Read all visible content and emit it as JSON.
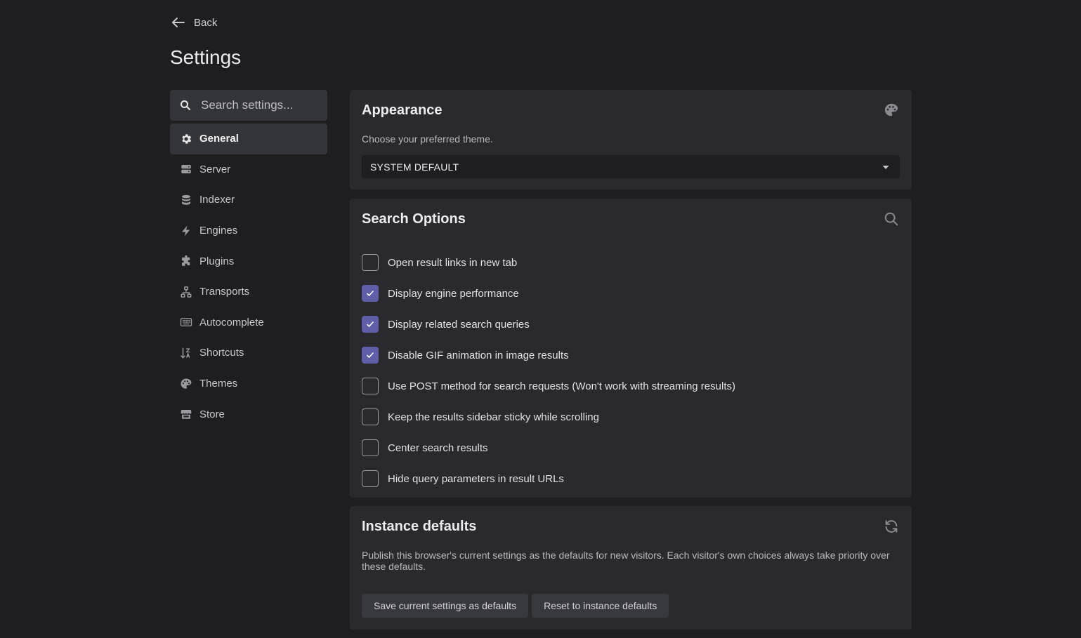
{
  "header": {
    "back_label": "Back",
    "title": "Settings"
  },
  "sidebar": {
    "search_placeholder": "Search settings...",
    "items": [
      {
        "label": "General",
        "icon": "gear-icon",
        "active": true
      },
      {
        "label": "Server",
        "icon": "server-icon"
      },
      {
        "label": "Indexer",
        "icon": "database-icon"
      },
      {
        "label": "Engines",
        "icon": "lightning-icon"
      },
      {
        "label": "Plugins",
        "icon": "puzzle-icon"
      },
      {
        "label": "Transports",
        "icon": "network-icon"
      },
      {
        "label": "Autocomplete",
        "icon": "keyboard-icon"
      },
      {
        "label": "Shortcuts",
        "icon": "sort-icon"
      },
      {
        "label": "Themes",
        "icon": "palette-icon"
      },
      {
        "label": "Store",
        "icon": "store-icon"
      }
    ]
  },
  "appearance": {
    "title": "Appearance",
    "description": "Choose your preferred theme.",
    "theme_value": "SYSTEM DEFAULT",
    "icon": "palette-icon"
  },
  "search_options": {
    "title": "Search Options",
    "icon": "search-icon",
    "options": [
      {
        "label": "Open result links in new tab",
        "checked": false
      },
      {
        "label": "Display engine performance",
        "checked": true
      },
      {
        "label": "Display related search queries",
        "checked": true
      },
      {
        "label": "Disable GIF animation in image results",
        "checked": true
      },
      {
        "label": "Use POST method for search requests (Won't work with streaming results)",
        "checked": false
      },
      {
        "label": "Keep the results sidebar sticky while scrolling",
        "checked": false
      },
      {
        "label": "Center search results",
        "checked": false
      },
      {
        "label": "Hide query parameters in result URLs",
        "checked": false
      }
    ]
  },
  "instance_defaults": {
    "title": "Instance defaults",
    "icon": "refresh-icon",
    "description": "Publish this browser's current settings as the defaults for new visitors. Each visitor's own choices always take priority over these defaults.",
    "save_label": "Save current settings as defaults",
    "reset_label": "Reset to instance defaults"
  },
  "colors": {
    "background": "#1e1e21",
    "card": "#2a2a2e",
    "accent": "#5e5fa8"
  }
}
